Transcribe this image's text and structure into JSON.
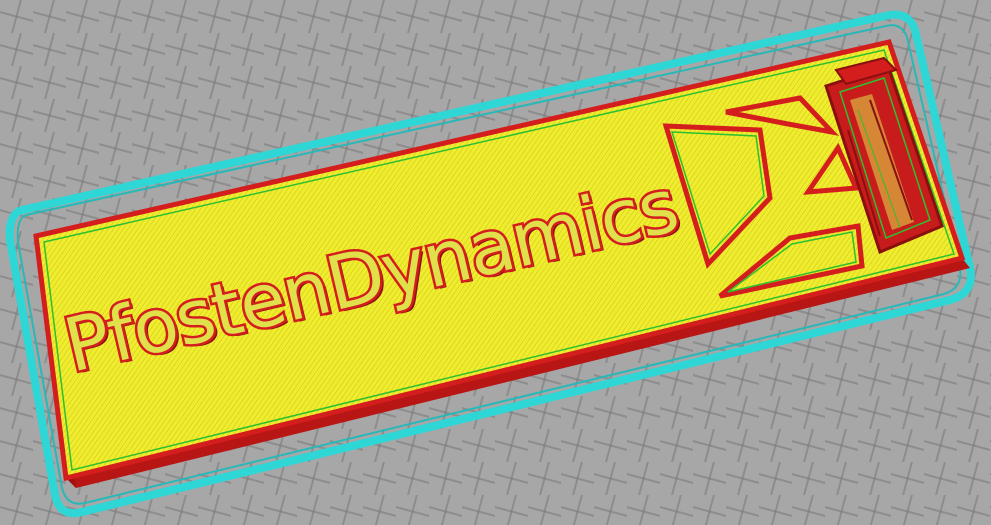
{
  "window": {
    "title": ""
  },
  "model": {
    "label_text": "PfostenDynamics",
    "colors": {
      "infill": "#f0ec2e",
      "wall": "#d41e1e",
      "inner_wall": "#2ec02e",
      "skirt": "#2fd6d6",
      "build_plate": "#a7a7a7",
      "grid_line": "#7a7a7a"
    }
  },
  "icons": {
    "logo": "axe-and-post-logo-icon"
  }
}
